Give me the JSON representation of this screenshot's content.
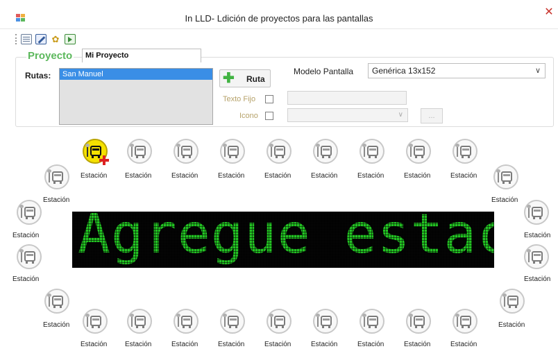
{
  "window": {
    "title": "In LLD- Ldición de proyectos para las pantallas",
    "close_glyph": "✕"
  },
  "toolbar": {
    "icons": [
      "new-project-icon",
      "edit-icon",
      "settings-icon",
      "export-icon"
    ]
  },
  "project": {
    "legend": "Proyecto",
    "name": "Mi Proyecto"
  },
  "routes": {
    "label": "Rutas:",
    "items": [
      "San Manuel"
    ],
    "selected": "San Manuel",
    "add_button_label": "Ruta"
  },
  "model": {
    "label": "Modelo Pantalla",
    "selected": "Genérica 13x152"
  },
  "fixed_text": {
    "label": "Texto Fijo",
    "checked": false,
    "value": ""
  },
  "icon": {
    "label": "Icono",
    "checked": false,
    "selected": "",
    "browse_label": "..."
  },
  "stations": {
    "label": "Estación",
    "active_index": 0,
    "top_row_labels": [
      "Estación",
      "Estación",
      "Estación",
      "Estación",
      "Estación",
      "Estación",
      "Estación",
      "Estación",
      "Estación"
    ],
    "bottom_row_labels": [
      "Estación",
      "Estación",
      "Estación",
      "Estación",
      "Estación",
      "Estación",
      "Estación",
      "Estación",
      "Estación"
    ],
    "left_labels": [
      "Estación",
      "Estación",
      "Estación",
      "Estación"
    ],
    "right_labels": [
      "Estación",
      "Estación",
      "Estación",
      "Estación"
    ]
  },
  "led_display": {
    "text": "Agregue estación",
    "color": "#23c423",
    "background": "#040404"
  },
  "colors": {
    "legend": "#5cb85c",
    "selection": "#3a8ee6",
    "active_station": "#f5e100"
  }
}
